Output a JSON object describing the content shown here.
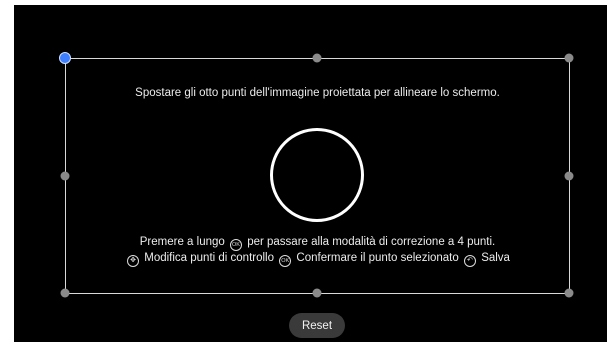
{
  "instructions": {
    "top": "Spostare gli otto punti dell'immagine proiettata per allineare lo schermo.",
    "line1_before": "Premere a lungo",
    "line1_after": "per passare alla modalità di correzione a 4 punti.",
    "nav_text": "Modifica punti di controllo",
    "ok_text": "Confermare il punto selezionato",
    "back_text": "Salva",
    "ok_glyph": "OK",
    "nav_glyph": "✥",
    "back_glyph": "↶"
  },
  "control_points": [
    {
      "name": "top-left",
      "selected": true
    },
    {
      "name": "top-center",
      "selected": false
    },
    {
      "name": "top-right",
      "selected": false
    },
    {
      "name": "middle-left",
      "selected": false
    },
    {
      "name": "middle-right",
      "selected": false
    },
    {
      "name": "bottom-left",
      "selected": false
    },
    {
      "name": "bottom-center",
      "selected": false
    },
    {
      "name": "bottom-right",
      "selected": false
    }
  ],
  "reset_label": "Reset",
  "colors": {
    "selected_point": "#3d7fff",
    "point": "#8a8a8a",
    "frame": "#d9d9d9",
    "background": "#000000"
  }
}
